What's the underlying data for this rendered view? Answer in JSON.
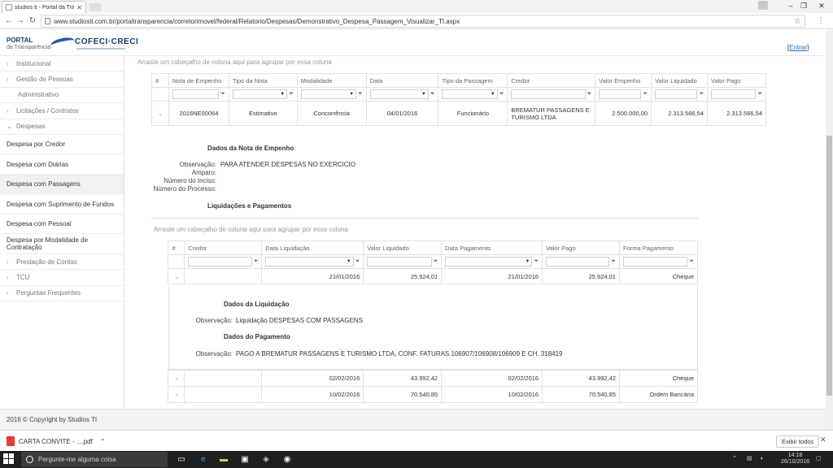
{
  "browser": {
    "tab_title": "studios ti - Portal da Tran",
    "url": "www.studiosti.com.br/portaltransparencia/corretorimovel/federal/Relatorio/Despesas/Demonstrativo_Despesa_Passagem_Visualizar_TI.aspx",
    "minimize": "–",
    "restore": "❐",
    "close": "✕"
  },
  "header": {
    "portal_line1": "PORTAL",
    "portal_line2": "da Transparência",
    "logo_text": "COFECI·CRECI",
    "login_open": "[",
    "login_label": "Entrar",
    "login_close": "]"
  },
  "sidebar": {
    "items": [
      {
        "label": "Institucional"
      },
      {
        "label": "Gestão de Pessoas"
      },
      {
        "label": "Administrativo"
      },
      {
        "label": "Licitações / Contratos"
      },
      {
        "label": "Despesas"
      },
      {
        "label": "Despesa por Credor"
      },
      {
        "label": "Despesa com Diárias"
      },
      {
        "label": "Despesa com Passagens"
      },
      {
        "label": "Despesa com Suprimento de Fundos"
      },
      {
        "label": "Despesa com Pessoal"
      },
      {
        "label": "Despesa por Modalidade de Contratação"
      },
      {
        "label": "Prestação de Contas"
      },
      {
        "label": "TCU"
      },
      {
        "label": "Perguntas Frequentes"
      }
    ]
  },
  "main": {
    "group_hint": "Arraste um cabeçalho de coluna aqui para agrupar por essa coluna",
    "columns": [
      "#",
      "Nota de Empenho",
      "Tipo da Nota",
      "Modalidade",
      "Data",
      "Tipo da Passagem",
      "Credor",
      "Valor Empenho",
      "Valor Liquidado",
      "Valor Pago"
    ],
    "row": {
      "nota": "2016NE00064",
      "tipo": "Estimativo",
      "modalidade": "Concorrência",
      "data": "04/01/2016",
      "tipo_passagem": "Funcionário",
      "credor": "BREMATUR PASSAGENS E TURISMO LTDA",
      "valor_empenho": "2.500.000,00",
      "valor_liquidado": "2.313.566,54",
      "valor_pago": "2.313.566,54"
    },
    "nota_detail": {
      "title": "Dados da Nota de Empenho",
      "obs_label": "Observação:",
      "obs_value": "PARA ATENDER DESPESAS NO EXERCICIO",
      "amparo_label": "Amparo:",
      "inciso_label": "Número do Inciso:",
      "processo_label": "Número do Processo:",
      "liq_title": "Liquidações e Pagamentos"
    },
    "sub_group_hint": "Arraste um cabeçalho de coluna aqui para agrupar por essa coluna",
    "sub_columns": [
      "#",
      "Credor",
      "Data Liquidação",
      "Valor Liquidado",
      "Data Pagamento",
      "Valor Pago",
      "Forma Pagamento"
    ],
    "sub_rows": [
      {
        "data_liq": "21/01/2016",
        "valor_liq": "25.924,01",
        "data_pag": "21/01/2016",
        "valor_pag": "25.924,01",
        "forma": "Cheque"
      },
      {
        "data_liq": "02/02/2016",
        "valor_liq": "43.992,42",
        "data_pag": "02/02/2016",
        "valor_pag": "43.992,42",
        "forma": "Cheque"
      },
      {
        "data_liq": "10/02/2016",
        "valor_liq": "70.540,85",
        "data_pag": "10/02/2016",
        "valor_pag": "70.540,85",
        "forma": "Ordem Bancária"
      }
    ],
    "liq_detail": {
      "title": "Dados da Liquidação",
      "obs_label": "Observação:",
      "obs_value": "Liquidação DESPESAS COM PASSAGENS",
      "pag_title": "Dados do Pagamento",
      "pag_obs_label": "Observação:",
      "pag_obs_value": "PAGO A BREMATUR PASSAGENS E TURISMO LTDA, CONF. FATURAS 106907/106908/106909 E CH. 318419"
    }
  },
  "footer": {
    "copyright": "2016 © Copyright by Studios TI"
  },
  "downloads": {
    "file": "CARTA CONVITE - ....pdf",
    "show_all": "Exibir todos"
  },
  "taskbar": {
    "search_placeholder": "Pergunte-me alguma coisa",
    "time": "14:18",
    "date": "26/10/2016"
  },
  "colors": {
    "accent": "#2a6ebb",
    "brand": "#1a3a6e"
  }
}
